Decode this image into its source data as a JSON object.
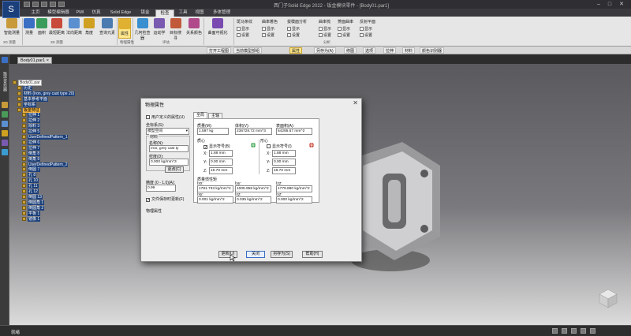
{
  "titlebar": {
    "app_button": "S",
    "title": "西门子Solid Edge 2022 - 钣金模块零件 - [Body01.par1]"
  },
  "tabs": [
    "主页",
    "模型编辑器",
    "PMI",
    "仿真",
    "Solid Edge Flex",
    "钣金",
    "检查",
    "工具",
    "视图",
    "多体管理"
  ],
  "active_tab": "检查",
  "ribbon": {
    "buttons": [
      {
        "label": "智能测量",
        "color": "#c89a3a"
      },
      {
        "label": "测量",
        "color": "#3a6fc4"
      },
      {
        "label": "面积",
        "color": "#3a9c5a"
      },
      {
        "label": "最短距离",
        "color": "#c84a3a"
      },
      {
        "label": "法向距离",
        "color": "#5a8fd0"
      },
      {
        "label": "角度",
        "color": "#d0a020"
      },
      {
        "label": "查询元素",
        "color": "#4a7ab0"
      },
      {
        "label": "属性",
        "color": "#e0b030"
      },
      {
        "label": "几何检查器",
        "color": "#3a8fd0"
      },
      {
        "label": "运动学",
        "color": "#7a5ab0"
      },
      {
        "label": "目标搜寻",
        "color": "#c05a3a"
      },
      {
        "label": "关系颜色",
        "color": "#b04a8a"
      },
      {
        "label": "曲面可视化",
        "color": "#7a4ab0"
      }
    ],
    "active_button": "属性",
    "groups": [
      "2D 测量",
      "3D 测量",
      "物理属性",
      "评估",
      "分析"
    ],
    "check_groups": [
      {
        "title": "斑马条纹",
        "items": [
          "显示",
          "设置"
        ]
      },
      {
        "title": "曲率着色",
        "items": [
          "显示",
          "设置"
        ]
      },
      {
        "title": "拔模面分析",
        "items": [
          "显示",
          "设置"
        ]
      },
      {
        "title": "曲率梳",
        "items": [
          "显示",
          "设置"
        ]
      },
      {
        "title": "菱面曲率",
        "items": [
          "显示",
          "设置"
        ]
      },
      {
        "title": "反射平面",
        "items": [
          "显示",
          "设置"
        ]
      }
    ]
  },
  "command_bar": {
    "items": [
      "打开工程图",
      "当前模型部组",
      "属性",
      "另存为(A)",
      "修图",
      "选项",
      "拉伸",
      "材料",
      "颜色识别器"
    ],
    "highlighted": "属性"
  },
  "left_toolbar": {
    "label": "路径查找器"
  },
  "doc_tab": {
    "label": "Body01.par1",
    "close": "×"
  },
  "tree": [
    {
      "label": "Body01.par",
      "style": "light"
    },
    {
      "label": "历史",
      "style": "dark"
    },
    {
      "label": "材料 (Iron, grey cast type 20)",
      "style": "dark"
    },
    {
      "label": "基本参考平面",
      "style": "dark"
    },
    {
      "label": "坐标系",
      "style": "dark"
    },
    {
      "label": "钣金特征",
      "style": "hl"
    },
    {
      "label": "拉伸 1",
      "style": "dark"
    },
    {
      "label": "拉伸 2",
      "style": "dark"
    },
    {
      "label": "除料 3",
      "style": "dark"
    },
    {
      "label": "拉伸 5",
      "style": "dark"
    },
    {
      "label": "UserDefinedPattern_1",
      "style": "dark"
    },
    {
      "label": "拉伸 6",
      "style": "dark"
    },
    {
      "label": "拉伸 7",
      "style": "dark"
    },
    {
      "label": "倒角 8",
      "style": "dark"
    },
    {
      "label": "倒角 9",
      "style": "dark"
    },
    {
      "label": "UserDefinedPattern_2",
      "style": "dark"
    },
    {
      "label": "倒圆 7",
      "style": "dark"
    },
    {
      "label": "孔 8",
      "style": "dark"
    },
    {
      "label": "孔 10",
      "style": "dark"
    },
    {
      "label": "孔 11",
      "style": "dark"
    },
    {
      "label": "孔 12",
      "style": "dark"
    },
    {
      "label": "倒圆 13",
      "style": "dark"
    },
    {
      "label": "倒圆角 1",
      "style": "dark"
    },
    {
      "label": "倒圆角 2",
      "style": "dark"
    },
    {
      "label": "平板 1",
      "style": "dark"
    },
    {
      "label": "镜像 1",
      "style": "dark"
    }
  ],
  "dialog": {
    "title": "物理属性",
    "close": "✕",
    "user_defined": "用户定义的属性(U)",
    "coord_label": "坐标系(S):",
    "coord_value": "模型空间",
    "material_group": "材料",
    "name_label": "名称(N):",
    "name_value": "Iron, grey cast ty",
    "density_label": "密度(D):",
    "density_value": "0.000 kg/mm^3",
    "change_button": "更改(C)",
    "accuracy_label": "精度 (0 - 1.0)(A):",
    "accuracy_value": "0.99",
    "save_on_update": "文件保存时更新(F)",
    "phys_props_label": "物理属性",
    "tabs": [
      "全局",
      "主轴"
    ],
    "active_tab": "全局",
    "mass_label": "质量(M):",
    "mass_value": "1.597 kg",
    "volume_label": "体积(V):",
    "volume_value": "236728.72 mm^3",
    "surface_label": "表面积(A):",
    "surface_value": "64295.67 mm^2",
    "centroid_group": "质心",
    "centroid_show": "显示符号(B)",
    "cm_group": "形心",
    "cm_show": "显示符号(I)",
    "cg": {
      "x": "1.88 mm",
      "y": "0.00 mm",
      "z": "19.70 mm"
    },
    "cm": {
      "x": "1.88 mm",
      "y": "0.00 mm",
      "z": "19.70 mm"
    },
    "axis_labels": [
      "X:",
      "Y:",
      "Z:"
    ],
    "moi_group": "质量惯性矩",
    "moi_labels": [
      "Ixx:",
      "Iyy:",
      "Izz:",
      "Ixy:",
      "Ixz:",
      "Iyz:"
    ],
    "moi_values": [
      "1781.733 kg/mm^2",
      "1005.958 kg/mm^2",
      "1779.880 kg/mm^2",
      "0.001 kg/mm^2",
      "0.035 kg/mm^2",
      "0.000 kg/mm^2"
    ],
    "buttons": [
      "更新(U)",
      "关闭",
      "另存为(S)",
      "帮助(H)"
    ],
    "default_button": "关闭"
  },
  "status": {
    "ready": "就绪"
  }
}
